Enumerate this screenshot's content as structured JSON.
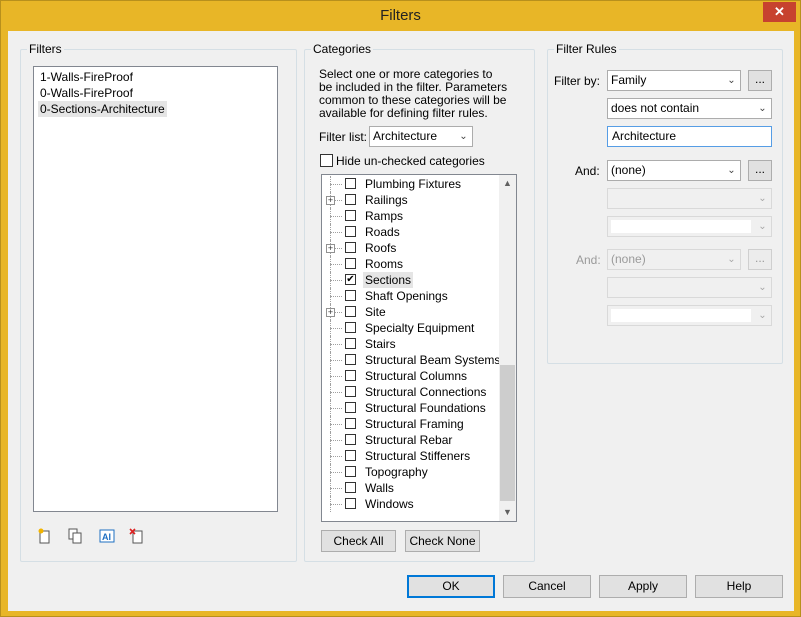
{
  "window": {
    "title": "Filters",
    "close_glyph": "✕"
  },
  "filters_group": {
    "title": "Filters",
    "items": [
      "1-Walls-FireProof",
      "0-Walls-FireProof",
      "0-Sections-Architecture"
    ],
    "toolbar_icons": [
      "new-filter-icon",
      "duplicate-filter-icon",
      "rename-filter-icon",
      "delete-filter-icon"
    ]
  },
  "categories_group": {
    "title": "Categories",
    "description": "Select one or more categories to be included in the filter.  Parameters common to these categories will be available for defining filter rules.",
    "filter_list_label": "Filter list:",
    "filter_list_value": "Architecture",
    "hide_unchecked_label": "Hide un-checked categories",
    "items": [
      {
        "label": "Plumbing Fixtures",
        "checked": false,
        "expandable": false
      },
      {
        "label": "Railings",
        "checked": false,
        "expandable": true
      },
      {
        "label": "Ramps",
        "checked": false,
        "expandable": false
      },
      {
        "label": "Roads",
        "checked": false,
        "expandable": false
      },
      {
        "label": "Roofs",
        "checked": false,
        "expandable": true
      },
      {
        "label": "Rooms",
        "checked": false,
        "expandable": false
      },
      {
        "label": "Sections",
        "checked": true,
        "expandable": false
      },
      {
        "label": "Shaft Openings",
        "checked": false,
        "expandable": false
      },
      {
        "label": "Site",
        "checked": false,
        "expandable": true
      },
      {
        "label": "Specialty Equipment",
        "checked": false,
        "expandable": false
      },
      {
        "label": "Stairs",
        "checked": false,
        "expandable": false
      },
      {
        "label": "Structural Beam Systems",
        "checked": false,
        "expandable": false
      },
      {
        "label": "Structural Columns",
        "checked": false,
        "expandable": false
      },
      {
        "label": "Structural Connections",
        "checked": false,
        "expandable": false
      },
      {
        "label": "Structural Foundations",
        "checked": false,
        "expandable": false
      },
      {
        "label": "Structural Framing",
        "checked": false,
        "expandable": false
      },
      {
        "label": "Structural Rebar",
        "checked": false,
        "expandable": false
      },
      {
        "label": "Structural Stiffeners",
        "checked": false,
        "expandable": false
      },
      {
        "label": "Topography",
        "checked": false,
        "expandable": false
      },
      {
        "label": "Walls",
        "checked": false,
        "expandable": false
      },
      {
        "label": "Windows",
        "checked": false,
        "expandable": false
      }
    ],
    "check_all_label": "Check All",
    "check_none_label": "Check None"
  },
  "filter_rules_group": {
    "title": "Filter Rules",
    "filter_by_label": "Filter by:",
    "filter_by_value": "Family",
    "operator_value": "does not contain",
    "value_text": "Architecture",
    "and1_label": "And:",
    "and1_value": "(none)",
    "and2_label": "And:",
    "and2_value": "(none)",
    "ellipsis": "..."
  },
  "footer": {
    "ok_label": "OK",
    "cancel_label": "Cancel",
    "apply_label": "Apply",
    "help_label": "Help"
  },
  "colors": {
    "title_bar": "#e8b627",
    "close_button": "#c7422f",
    "default_button_border": "#0078d7"
  }
}
